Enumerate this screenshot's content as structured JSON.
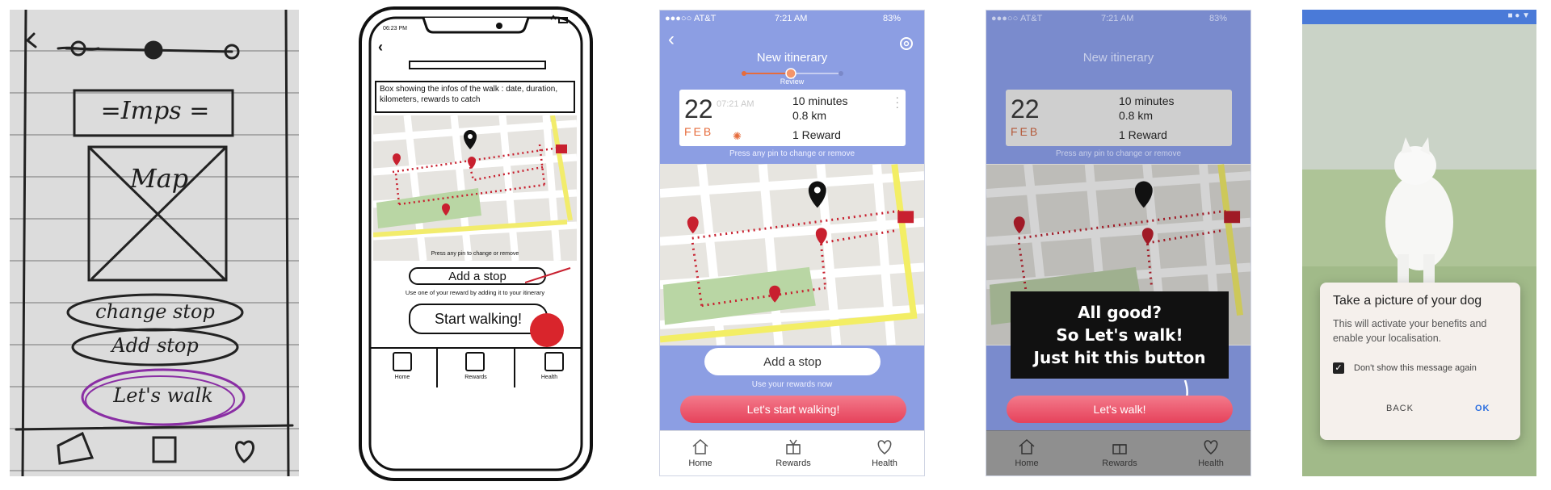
{
  "sketch": {
    "title": "=Imps =",
    "map_label": "Map",
    "change_stop": "change stop",
    "add_stop": "Add stop",
    "lets_walk": "Let's walk"
  },
  "wireframe": {
    "clock": "06:23 PM",
    "info_box": "Box showing the infos of the walk : date, duration, kilometers, rewards to catch",
    "pin_hint": "Press any pin to change or remove",
    "add_stop": "Add a stop",
    "reward_hint": "Use one of your reward by adding it to your itinerary",
    "start_walking": "Start walking!",
    "tabs": [
      "Home",
      "Rewards",
      "Health"
    ]
  },
  "hifi": {
    "carrier": "AT&T",
    "time": "7:21 AM",
    "battery": "83%",
    "title": "New itinerary",
    "step_label": "Review",
    "day": "22",
    "month": "FEB",
    "start_time": "07:21 AM",
    "duration": "10 minutes",
    "distance": "0.8 km",
    "rewards": "1 Reward",
    "pin_hint": "Press any pin to change or remove",
    "add_stop": "Add a stop",
    "rewards_hint": "Use your rewards now",
    "start_button": "Let's start walking!",
    "tabs": [
      "Home",
      "Rewards",
      "Health"
    ]
  },
  "tooltip": {
    "line1": "All good?",
    "line2": "So Let's walk!",
    "line3": "Just hit this button",
    "walk_button": "Let's walk!"
  },
  "dialog": {
    "title": "Take a picture of your dog",
    "body": "This will activate your benefits and enable your localisation.",
    "checkbox_label": "Don't show this message again",
    "back": "BACK",
    "ok": "OK"
  },
  "colors": {
    "accent": "#e6425b",
    "hifi_bg": "#8c9ee3",
    "pin": "#c8202f",
    "route": "#c8202f",
    "android_bar": "#4a7ad8"
  }
}
